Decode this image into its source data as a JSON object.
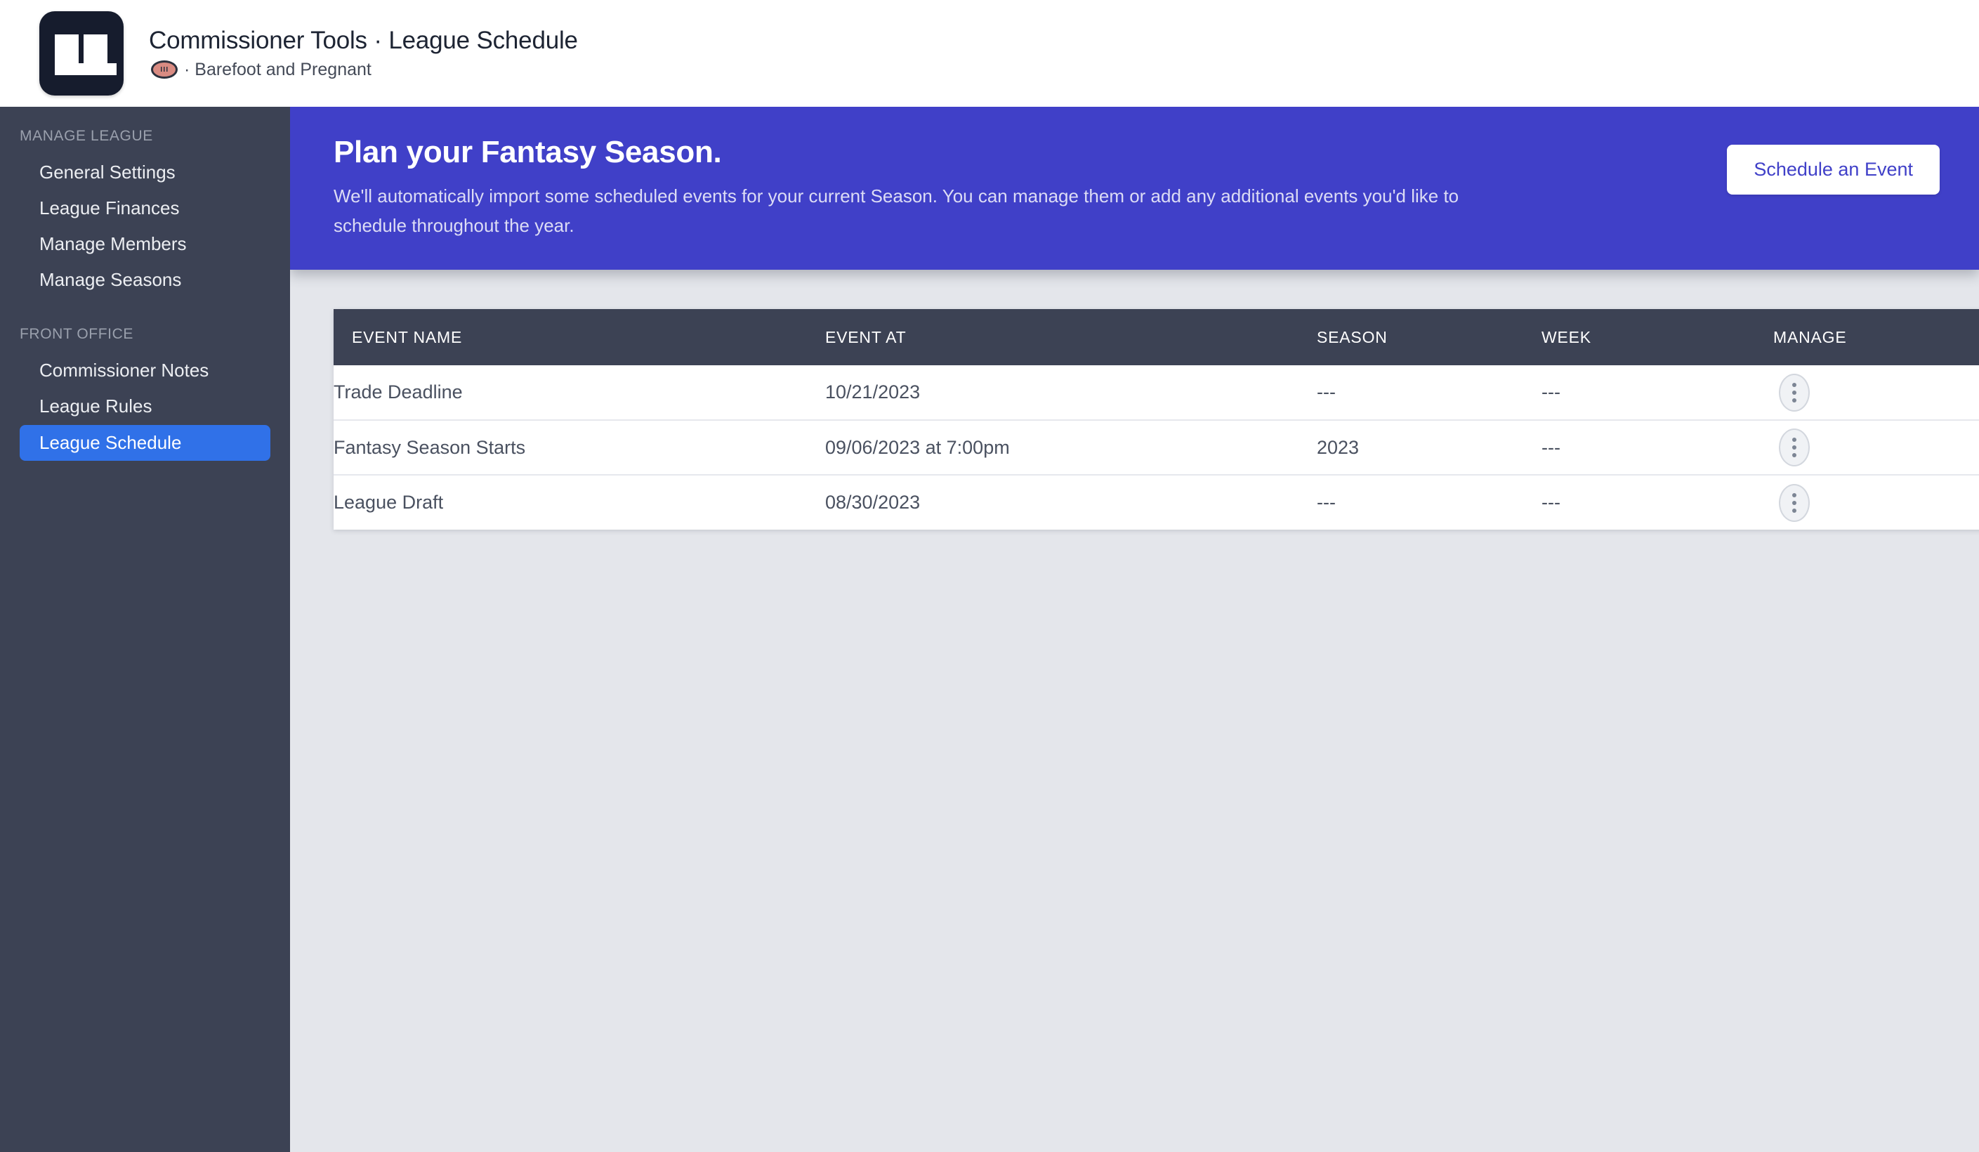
{
  "header": {
    "logo_text": "LL",
    "title": "Commissioner Tools · League Schedule",
    "league_icon": "football-icon",
    "league_name": "· Barefoot and Pregnant"
  },
  "sidebar": {
    "sections": [
      {
        "label": "MANAGE LEAGUE",
        "items": [
          {
            "label": "General Settings",
            "active": false
          },
          {
            "label": "League Finances",
            "active": false
          },
          {
            "label": "Manage Members",
            "active": false
          },
          {
            "label": "Manage Seasons",
            "active": false
          }
        ]
      },
      {
        "label": "FRONT OFFICE",
        "items": [
          {
            "label": "Commissioner Notes",
            "active": false
          },
          {
            "label": "League Rules",
            "active": false
          },
          {
            "label": "League Schedule",
            "active": true
          }
        ]
      }
    ]
  },
  "hero": {
    "title": "Plan your Fantasy Season.",
    "description": "We'll automatically import some scheduled events for your current Season. You can manage them or add any additional events you'd like to schedule throughout the year.",
    "cta_label": "Schedule an Event",
    "background_color": "#4040c8"
  },
  "table": {
    "columns": [
      "EVENT NAME",
      "EVENT AT",
      "SEASON",
      "WEEK",
      "MANAGE"
    ],
    "rows": [
      {
        "event_name": "Trade Deadline",
        "event_at": "10/21/2023",
        "season": "---",
        "week": "---",
        "manage_icon": "kebab-menu-icon"
      },
      {
        "event_name": "Fantasy Season Starts",
        "event_at": "09/06/2023 at 7:00pm",
        "season": "2023",
        "week": "---",
        "manage_icon": "kebab-menu-icon"
      },
      {
        "event_name": "League Draft",
        "event_at": "08/30/2023",
        "season": "---",
        "week": "---",
        "manage_icon": "kebab-menu-icon"
      }
    ]
  },
  "colors": {
    "sidebar": "#3c4254",
    "accent_blue": "#3071e8",
    "hero_indigo": "#4040c8",
    "page_background": "#e4e6eb",
    "logo_navy": "#161c2d"
  }
}
